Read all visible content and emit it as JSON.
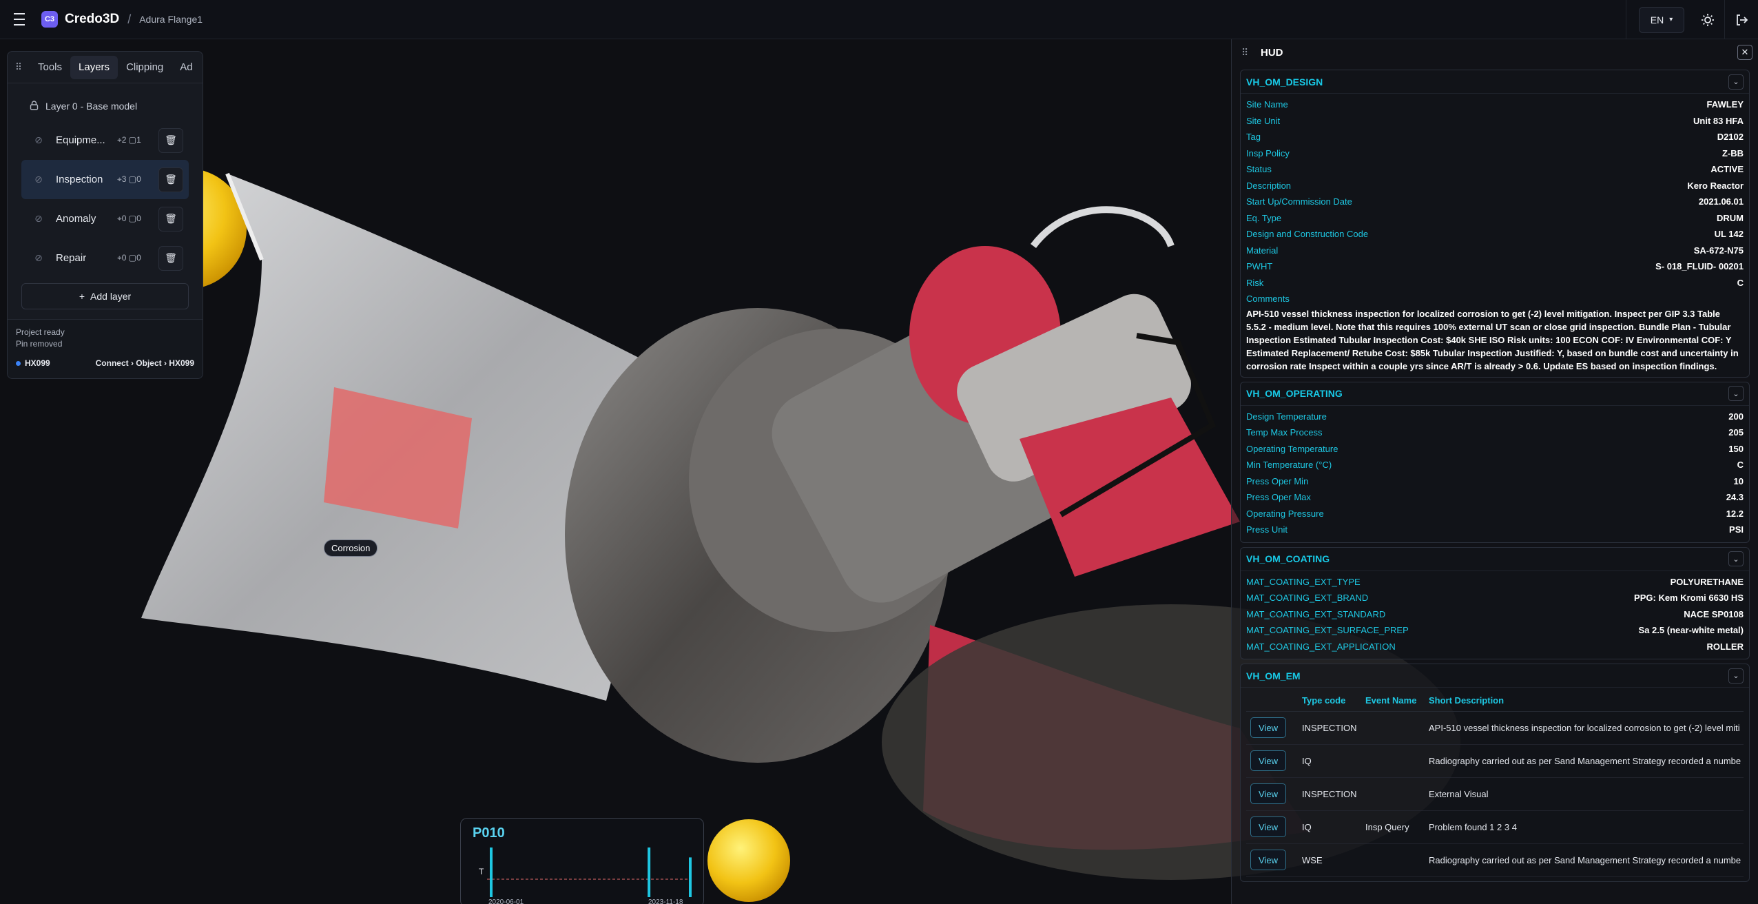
{
  "topbar": {
    "logo": "C3",
    "app_name": "Credo3D",
    "separator": "/",
    "breadcrumb": "Adura Flange1",
    "language": "EN"
  },
  "viewport": {
    "marker_label": "Corrosion"
  },
  "left_panel": {
    "tabs": [
      "Tools",
      "Layers",
      "Clipping",
      "Ad"
    ],
    "active_tab": "Layers",
    "base_layer": "Layer 0 - Base model",
    "layers": [
      {
        "name": "Equipme...",
        "pins": "2",
        "boxes": "1"
      },
      {
        "name": "Inspection",
        "pins": "3",
        "boxes": "0"
      },
      {
        "name": "Anomaly",
        "pins": "0",
        "boxes": "0"
      },
      {
        "name": "Repair",
        "pins": "0",
        "boxes": "0"
      }
    ],
    "add_layer": "Add layer",
    "status_1": "Project ready",
    "status_2": "Pin removed",
    "object_id": "HX099",
    "object_path": "Connect › Object › HX099"
  },
  "mini_chart": {
    "title": "P010",
    "y_label": "T",
    "x_start": "2020-06-01",
    "x_end": "2023-11-18"
  },
  "chart_data": {
    "type": "bar",
    "title": "P010",
    "ylabel": "T",
    "x": [
      "2020-06-01",
      "2023-11-18"
    ],
    "bars": [
      {
        "x": "2020-06-01",
        "value": 1
      },
      {
        "x": "2023-03-01",
        "value": 1
      },
      {
        "x": "2023-11-18",
        "value": 0.8
      }
    ],
    "threshold_line": true
  },
  "hud": {
    "title": "HUD",
    "design": {
      "title": "VH_OM_DESIGN",
      "rows": [
        {
          "k": "Site Name",
          "v": "FAWLEY"
        },
        {
          "k": "Site Unit",
          "v": "Unit 83 HFA"
        },
        {
          "k": "Tag",
          "v": "D2102"
        },
        {
          "k": "Insp Policy",
          "v": "Z-BB"
        },
        {
          "k": "Status",
          "v": "ACTIVE"
        },
        {
          "k": "Description",
          "v": "Kero Reactor"
        },
        {
          "k": "Start Up/Commission Date",
          "v": "2021.06.01"
        },
        {
          "k": "Eq. Type",
          "v": "DRUM"
        },
        {
          "k": "Design and Construction Code",
          "v": "UL 142"
        },
        {
          "k": "Material",
          "v": "SA-672-N75"
        },
        {
          "k": "PWHT",
          "v": "S- 018_FLUID- 00201"
        },
        {
          "k": "Risk",
          "v": "C"
        }
      ],
      "comments_label": "Comments",
      "comments": "API-510 vessel thickness inspection for localized corrosion to get (-2) level mitigation. Inspect per GIP 3.3 Table 5.5.2 - medium level. Note that this requires 100% external UT scan or close grid inspection. Bundle Plan - Tubular Inspection Estimated Tubular Inspection Cost: $40k SHE ISO Risk units: 100 ECON COF: IV Environmental COF: Y Estimated Replacement/ Retube Cost: $85k Tubular Inspection Justified: Y, based on bundle cost and uncertainty in corrosion rate Inspect within a couple yrs since AR/T is already > 0.6. Update ES based on inspection findings."
    },
    "operating": {
      "title": "VH_OM_OPERATING",
      "rows": [
        {
          "k": "Design Temperature",
          "v": "200"
        },
        {
          "k": "Temp Max Process",
          "v": "205"
        },
        {
          "k": "Operating Temperature",
          "v": "150"
        },
        {
          "k": "Min Temperature (°C)",
          "v": "C"
        },
        {
          "k": "Press Oper Min",
          "v": "10"
        },
        {
          "k": "Press Oper Max",
          "v": "24.3"
        },
        {
          "k": "Operating Pressure",
          "v": "12.2"
        },
        {
          "k": "Press Unit",
          "v": "PSI"
        }
      ]
    },
    "coating": {
      "title": "VH_OM_COATING",
      "rows": [
        {
          "k": "MAT_COATING_EXT_TYPE",
          "v": "POLYURETHANE"
        },
        {
          "k": "MAT_COATING_EXT_BRAND",
          "v": "PPG: Kem Kromi 6630 HS"
        },
        {
          "k": "MAT_COATING_EXT_STANDARD",
          "v": "NACE SP0108"
        },
        {
          "k": "MAT_COATING_EXT_SURFACE_PREP",
          "v": "Sa 2.5 (near-white metal)"
        },
        {
          "k": "MAT_COATING_EXT_APPLICATION",
          "v": "ROLLER"
        }
      ]
    },
    "em": {
      "title": "VH_OM_EM",
      "columns": [
        "",
        "Type code",
        "Event Name",
        "Short Description"
      ],
      "view_label": "View",
      "rows": [
        {
          "type": "INSPECTION",
          "event": "",
          "desc": "API-510 vessel thickness inspection for localized corrosion to get (-2) level miti"
        },
        {
          "type": "IQ",
          "event": "",
          "desc": "Radiography carried out as per Sand Management Strategy recorded a numbe"
        },
        {
          "type": "INSPECTION",
          "event": "",
          "desc": "External Visual"
        },
        {
          "type": "IQ",
          "event": "Insp Query",
          "desc": "Problem found 1 2 3 4"
        },
        {
          "type": "WSE",
          "event": "",
          "desc": "Radiography carried out as per Sand Management Strategy recorded a numbe"
        }
      ]
    }
  }
}
